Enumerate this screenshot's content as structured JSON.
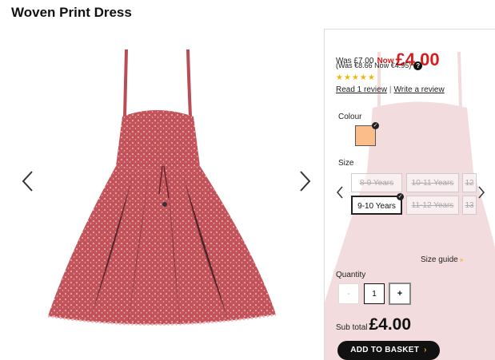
{
  "product": {
    "title": "Woven Print Dress"
  },
  "pricing": {
    "was": "Was £7.00",
    "now_label": "Now",
    "now_price": "£4.00",
    "euro_note": "(Was €8.66 Now €4.95)",
    "help": "?"
  },
  "reviews": {
    "stars": "★★★★★",
    "rating": 5,
    "read_link": "Read 1 review",
    "separator": "|",
    "write_link": "Write a review"
  },
  "colour": {
    "label": "Colour",
    "swatch_color": "#fbbd8a",
    "check": "✓"
  },
  "size": {
    "label": "Size",
    "options": [
      {
        "label": "8-9 Years"
      },
      {
        "label": "10-11 Years"
      },
      {
        "label": "12"
      },
      {
        "label": "9-10 Years"
      },
      {
        "label": "11-12 Years"
      },
      {
        "label": "13"
      }
    ],
    "guide": "Size guide",
    "guide_arrow": "»"
  },
  "quantity": {
    "label": "Quantity",
    "value": "1",
    "minus": "-",
    "plus": "+"
  },
  "subtotal": {
    "label": "Sub total",
    "amount": "£4.00"
  },
  "basket": {
    "label": "ADD TO BASKET",
    "arrow": "›"
  },
  "colors": {
    "dress": "#c4545c",
    "price_red": "#d51f1f",
    "star": "#f3b600",
    "button": "#111111"
  }
}
